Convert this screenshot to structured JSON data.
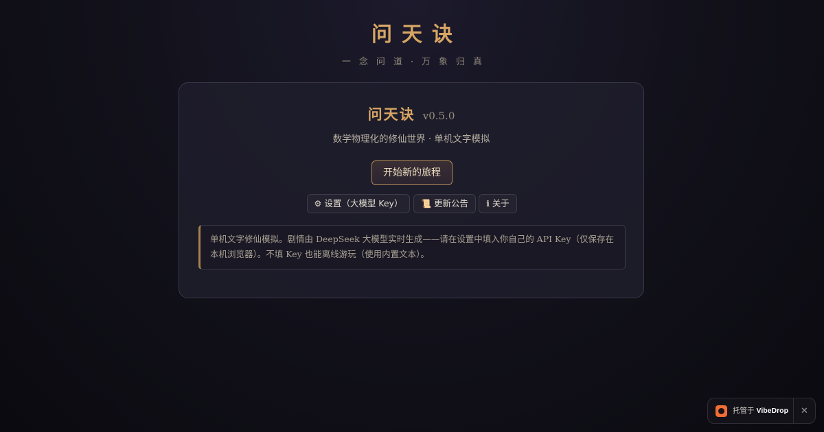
{
  "header": {
    "title": "问天诀",
    "subtitle": "一念问道·万象归真"
  },
  "card": {
    "title": "问天诀",
    "version": "v0.5.0",
    "tagline": "数学物理化的修仙世界 · 单机文字模拟",
    "start_label": "开始新的旅程",
    "buttons": {
      "settings_icon": "⚙",
      "settings_label": "设置（大模型 Key）",
      "notice_icon": "📜",
      "notice_label": "更新公告",
      "about_icon": "ℹ",
      "about_label": "关于"
    },
    "notice": "单机文字修仙模拟。剧情由 DeepSeek 大模型实时生成——请在设置中填入你自己的 API Key（仅保存在本机浏览器）。不填 Key 也能离线游玩（使用内置文本）。"
  },
  "badge": {
    "prefix": "托管于",
    "brand": "VibeDrop",
    "close": "✕"
  },
  "colors": {
    "accent": "#d7a564",
    "background": "#13121c",
    "badge_logo": "#f06d35"
  },
  "icons": [
    "gear-icon",
    "scroll-icon",
    "info-icon",
    "vibedrop-logo-icon",
    "close-icon"
  ]
}
